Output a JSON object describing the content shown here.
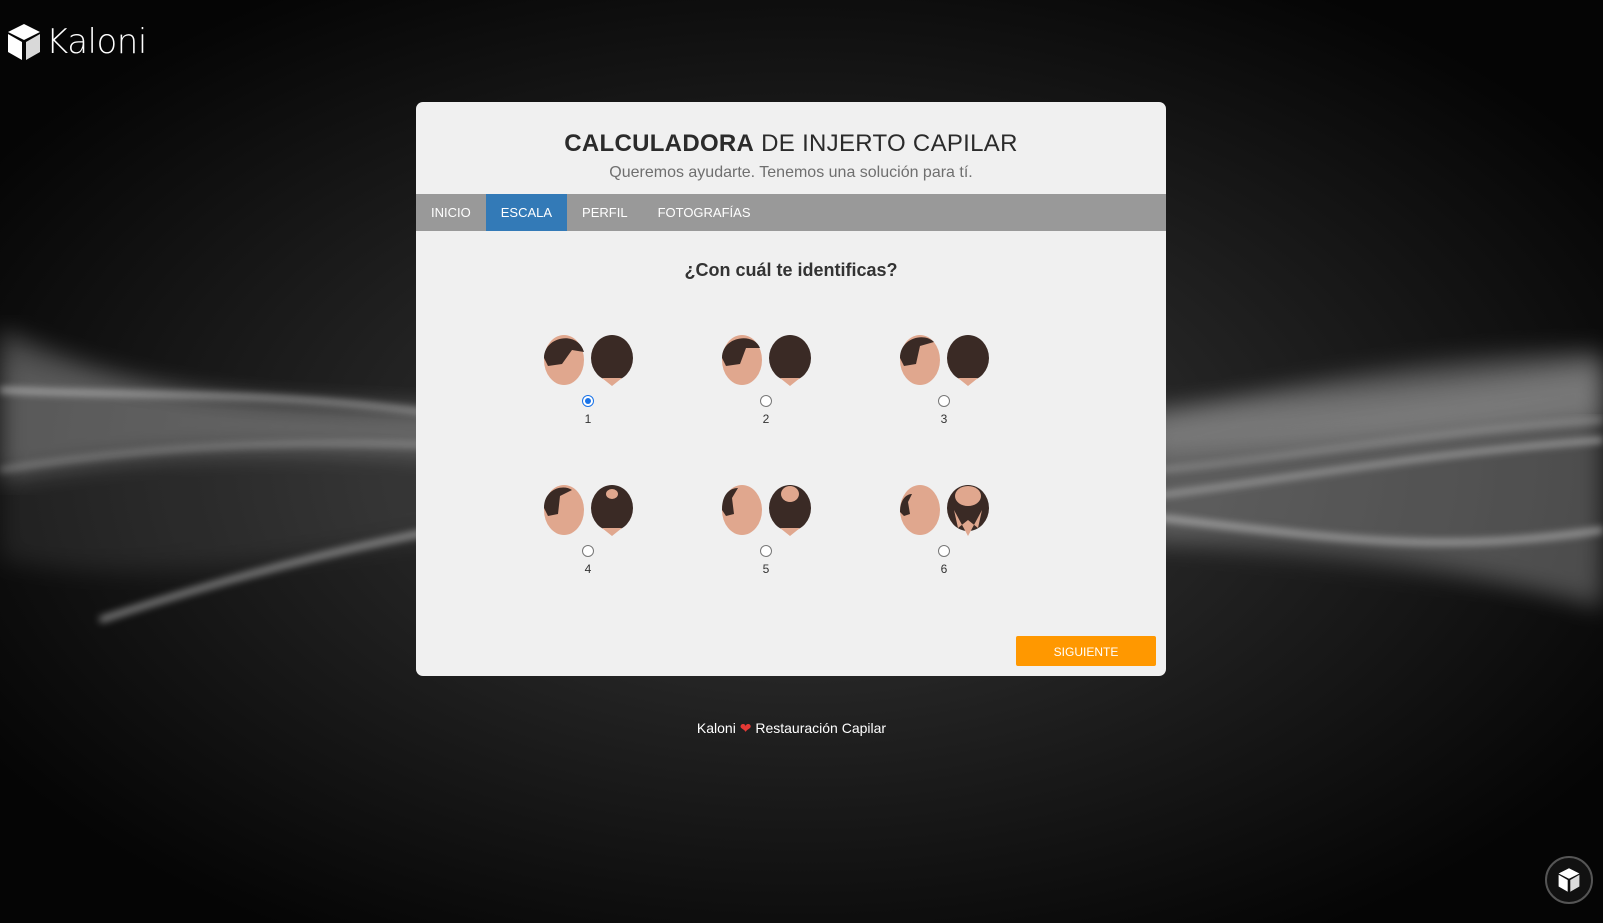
{
  "brand": {
    "name": "Kaloni",
    "logo_icon": "cube-logo-icon"
  },
  "card": {
    "title_bold": "CALCULADORA",
    "title_rest": " DE INJERTO CAPILAR",
    "subtitle": "Queremos ayudarte. Tenemos una solución para tí.",
    "tabs": [
      {
        "label": "INICIO",
        "active": false
      },
      {
        "label": "ESCALA",
        "active": true
      },
      {
        "label": "PERFIL",
        "active": false
      },
      {
        "label": "FOTOGRAFÍAS",
        "active": false
      }
    ],
    "question": "¿Con cuál te identificas?",
    "options": [
      {
        "label": "1",
        "selected": true
      },
      {
        "label": "2",
        "selected": false
      },
      {
        "label": "3",
        "selected": false
      },
      {
        "label": "4",
        "selected": false
      },
      {
        "label": "5",
        "selected": false
      },
      {
        "label": "6",
        "selected": false
      }
    ],
    "next_label": "SIGUIENTE"
  },
  "footer": {
    "left": "Kaloni",
    "heart": "❤",
    "right": "Restauración Capilar"
  },
  "chat": {
    "icon": "cube-chat-icon"
  },
  "colors": {
    "accent": "#337ab7",
    "button": "#ff9800",
    "tabbar": "#999999"
  }
}
